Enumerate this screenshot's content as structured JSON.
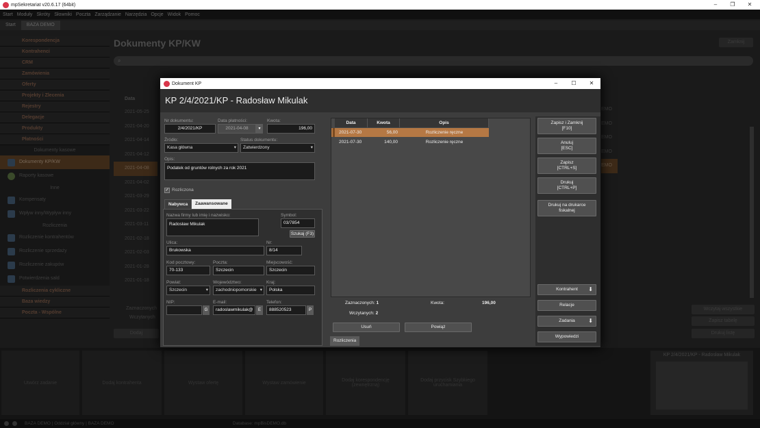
{
  "app": {
    "title": "mpSekretariat v20.6.17 (64bit)",
    "menu": [
      "Start",
      "Moduły",
      "Skróty",
      "Słowniki",
      "Poczta",
      "Zarządzanie",
      "Narzędzia",
      "Opcje",
      "Widok",
      "Pomoc"
    ],
    "tabs": [
      "Start",
      "BAZA DEMO"
    ]
  },
  "left_panel": {
    "groups_top": [
      "Korespondencja",
      "Kontrahenci",
      "CRM",
      "Zamówienia",
      "Oferty",
      "Projekty i Zlecenia",
      "Rejestry",
      "Delegacje",
      "Produkty",
      "Płatności"
    ],
    "section_dokumenty": "Dokumenty kasowe",
    "items_dokumenty": [
      "Dokumenty KP/KW",
      "Raporty kasowe"
    ],
    "section_inne": "Inne",
    "items_inne": [
      "Kompensaty",
      "Wpływ inny/Wypływ inny"
    ],
    "section_rozliczenia": "Rozliczenia",
    "items_rozliczenia": [
      "Rozliczenie kontrahentów",
      "Rozliczenie sprzedaży",
      "Rozliczenie zakupów",
      "Potwierdzenia sald"
    ],
    "groups_bottom": [
      "Rozliczenia cykliczne",
      "Baza wiedzy",
      "Poczta - Wspólne"
    ]
  },
  "background": {
    "title": "Dokumenty KP/KW",
    "close_label": "Zamknij",
    "date_header": "Data",
    "dates": [
      "2021-05-25",
      "2021-04-20",
      "2021-04-14",
      "2021-04-12",
      "2021-04-08",
      "2021-04-02",
      "2021-03-29",
      "2021-03-22",
      "2021-03-11",
      "2021-02-18",
      "2021-02-03",
      "2021-01-28",
      "2021-01-18"
    ],
    "zaznaczonych": "Zaznaczonych",
    "wczytanych": "Wczytanych",
    "dodaj": "Dodaj",
    "right_buttons": [
      "Wczytaj wszystkie",
      "Zapisz tabelę",
      "Drukuj listę"
    ],
    "preview_title": "KP 2/4/2021/KP - Radosław Mikulak"
  },
  "bottom_cards": [
    "Utwórz zadanie",
    "Dodaj kontrahenta",
    "Wystaw ofertę",
    "Wystaw zamówienie",
    "Dodaj korespondencję (zewnętrzną)",
    "Dodaj przycisk Szybkiego uruchamiania"
  ],
  "status": {
    "left": "BAZA DEMO | Oddział główny | BAZA DEMO",
    "db": "Database: mpBisDEMO.db"
  },
  "dialog": {
    "window_title": "Dokument KP",
    "header": "KP 2/4/2021/KP - Radosław Mikulak",
    "fields": {
      "nr_label": "Nr dokumentu:",
      "nr_value": "2/4/2021/KP",
      "data_label": "Data płatności:",
      "data_value": "2021-04-08",
      "kwota_label": "Kwota:",
      "kwota_value": "196,00",
      "zrodlo_label": "Źródło:",
      "zrodlo_value": "Kasa główna",
      "status_label": "Status dokumentu:",
      "status_value": "Zatwierdzony",
      "opis_label": "Opis:",
      "opis_value": "Podatek od gruntów rolnych za rok 2021",
      "rozliczona_label": "Rozliczona"
    },
    "tabs": [
      "Nabywca",
      "Zaawansowane"
    ],
    "nabywca": {
      "name_label": "Nazwa firmy lub imię i nazwisko:",
      "name_value": "Radosław Mikulak",
      "symbol_label": "Symbol:",
      "symbol_value": "03/7854",
      "search_btn": "Szukaj (F3)",
      "ulica_label": "Ulica:",
      "ulica_value": "Brukowska",
      "nr_label": "Nr:",
      "nr_value": "8/14",
      "kod_label": "Kod pocztowy:",
      "kod_value": "70-133",
      "poczta_label": "Poczta:",
      "poczta_value": "Szczecin",
      "miejsc_label": "Miejscowość:",
      "miejsc_value": "Szczecin",
      "powiat_label": "Powiat:",
      "powiat_value": "Szczecin",
      "woj_label": "Województwo:",
      "woj_value": "zachodniopomorskie",
      "kraj_label": "Kraj:",
      "kraj_value": "Polska",
      "nip_label": "NIP:",
      "nip_value": "",
      "nip_btn": "G",
      "email_label": "E-mail:",
      "email_value": "radoslawmikulak@",
      "email_btn": "E",
      "tel_label": "Telefon:",
      "tel_value": "888520523",
      "tel_btn": "P"
    },
    "grid": {
      "headers": [
        "Data",
        "Kwota",
        "Opis"
      ],
      "rows": [
        {
          "date": "2021-07-30",
          "amount": "56,00",
          "desc": "Rozliczenie ręczne"
        },
        {
          "date": "2021-07-30",
          "amount": "140,00",
          "desc": "Rozliczenie ręczne"
        }
      ]
    },
    "summary": {
      "zaznaczonych_label": "Zaznaczonych:",
      "zaznaczonych_value": "1",
      "wczytanych_label": "Wczytanych:",
      "wczytanych_value": "2",
      "kwota_label": "Kwota:",
      "kwota_value": "196,00",
      "usun": "Usuń",
      "powiaz": "Powiąż",
      "tab": "Rozliczenia"
    },
    "side_buttons": {
      "save_close": [
        "Zapisz i Zamknij",
        "[F10]"
      ],
      "cancel": [
        "Anuluj",
        "[ESC]"
      ],
      "save": [
        "Zapisz",
        "[CTRL+S]"
      ],
      "print": [
        "Drukuj",
        "[CTRL+P]"
      ],
      "fiscal": [
        "Drukuj na drukarce",
        "fiskalnej"
      ],
      "kontrahent": "Kontrahent",
      "relacje": "Relacje",
      "zadania": "Zadania",
      "wypowiedzi": "Wypowiedzi"
    }
  }
}
